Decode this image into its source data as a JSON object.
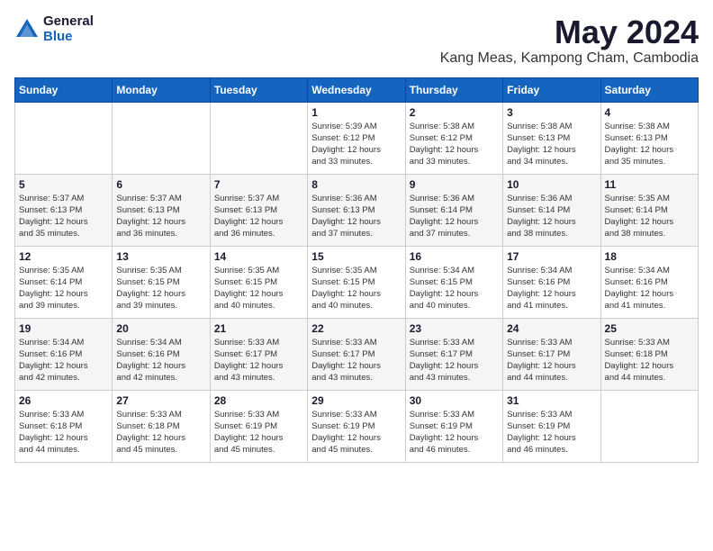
{
  "header": {
    "logo_general": "General",
    "logo_blue": "Blue",
    "month_title": "May 2024",
    "location": "Kang Meas, Kampong Cham, Cambodia"
  },
  "days_of_week": [
    "Sunday",
    "Monday",
    "Tuesday",
    "Wednesday",
    "Thursday",
    "Friday",
    "Saturday"
  ],
  "weeks": [
    [
      {
        "day": "",
        "info": ""
      },
      {
        "day": "",
        "info": ""
      },
      {
        "day": "",
        "info": ""
      },
      {
        "day": "1",
        "info": "Sunrise: 5:39 AM\nSunset: 6:12 PM\nDaylight: 12 hours\nand 33 minutes."
      },
      {
        "day": "2",
        "info": "Sunrise: 5:38 AM\nSunset: 6:12 PM\nDaylight: 12 hours\nand 33 minutes."
      },
      {
        "day": "3",
        "info": "Sunrise: 5:38 AM\nSunset: 6:13 PM\nDaylight: 12 hours\nand 34 minutes."
      },
      {
        "day": "4",
        "info": "Sunrise: 5:38 AM\nSunset: 6:13 PM\nDaylight: 12 hours\nand 35 minutes."
      }
    ],
    [
      {
        "day": "5",
        "info": "Sunrise: 5:37 AM\nSunset: 6:13 PM\nDaylight: 12 hours\nand 35 minutes."
      },
      {
        "day": "6",
        "info": "Sunrise: 5:37 AM\nSunset: 6:13 PM\nDaylight: 12 hours\nand 36 minutes."
      },
      {
        "day": "7",
        "info": "Sunrise: 5:37 AM\nSunset: 6:13 PM\nDaylight: 12 hours\nand 36 minutes."
      },
      {
        "day": "8",
        "info": "Sunrise: 5:36 AM\nSunset: 6:13 PM\nDaylight: 12 hours\nand 37 minutes."
      },
      {
        "day": "9",
        "info": "Sunrise: 5:36 AM\nSunset: 6:14 PM\nDaylight: 12 hours\nand 37 minutes."
      },
      {
        "day": "10",
        "info": "Sunrise: 5:36 AM\nSunset: 6:14 PM\nDaylight: 12 hours\nand 38 minutes."
      },
      {
        "day": "11",
        "info": "Sunrise: 5:35 AM\nSunset: 6:14 PM\nDaylight: 12 hours\nand 38 minutes."
      }
    ],
    [
      {
        "day": "12",
        "info": "Sunrise: 5:35 AM\nSunset: 6:14 PM\nDaylight: 12 hours\nand 39 minutes."
      },
      {
        "day": "13",
        "info": "Sunrise: 5:35 AM\nSunset: 6:15 PM\nDaylight: 12 hours\nand 39 minutes."
      },
      {
        "day": "14",
        "info": "Sunrise: 5:35 AM\nSunset: 6:15 PM\nDaylight: 12 hours\nand 40 minutes."
      },
      {
        "day": "15",
        "info": "Sunrise: 5:35 AM\nSunset: 6:15 PM\nDaylight: 12 hours\nand 40 minutes."
      },
      {
        "day": "16",
        "info": "Sunrise: 5:34 AM\nSunset: 6:15 PM\nDaylight: 12 hours\nand 40 minutes."
      },
      {
        "day": "17",
        "info": "Sunrise: 5:34 AM\nSunset: 6:16 PM\nDaylight: 12 hours\nand 41 minutes."
      },
      {
        "day": "18",
        "info": "Sunrise: 5:34 AM\nSunset: 6:16 PM\nDaylight: 12 hours\nand 41 minutes."
      }
    ],
    [
      {
        "day": "19",
        "info": "Sunrise: 5:34 AM\nSunset: 6:16 PM\nDaylight: 12 hours\nand 42 minutes."
      },
      {
        "day": "20",
        "info": "Sunrise: 5:34 AM\nSunset: 6:16 PM\nDaylight: 12 hours\nand 42 minutes."
      },
      {
        "day": "21",
        "info": "Sunrise: 5:33 AM\nSunset: 6:17 PM\nDaylight: 12 hours\nand 43 minutes."
      },
      {
        "day": "22",
        "info": "Sunrise: 5:33 AM\nSunset: 6:17 PM\nDaylight: 12 hours\nand 43 minutes."
      },
      {
        "day": "23",
        "info": "Sunrise: 5:33 AM\nSunset: 6:17 PM\nDaylight: 12 hours\nand 43 minutes."
      },
      {
        "day": "24",
        "info": "Sunrise: 5:33 AM\nSunset: 6:17 PM\nDaylight: 12 hours\nand 44 minutes."
      },
      {
        "day": "25",
        "info": "Sunrise: 5:33 AM\nSunset: 6:18 PM\nDaylight: 12 hours\nand 44 minutes."
      }
    ],
    [
      {
        "day": "26",
        "info": "Sunrise: 5:33 AM\nSunset: 6:18 PM\nDaylight: 12 hours\nand 44 minutes."
      },
      {
        "day": "27",
        "info": "Sunrise: 5:33 AM\nSunset: 6:18 PM\nDaylight: 12 hours\nand 45 minutes."
      },
      {
        "day": "28",
        "info": "Sunrise: 5:33 AM\nSunset: 6:19 PM\nDaylight: 12 hours\nand 45 minutes."
      },
      {
        "day": "29",
        "info": "Sunrise: 5:33 AM\nSunset: 6:19 PM\nDaylight: 12 hours\nand 45 minutes."
      },
      {
        "day": "30",
        "info": "Sunrise: 5:33 AM\nSunset: 6:19 PM\nDaylight: 12 hours\nand 46 minutes."
      },
      {
        "day": "31",
        "info": "Sunrise: 5:33 AM\nSunset: 6:19 PM\nDaylight: 12 hours\nand 46 minutes."
      },
      {
        "day": "",
        "info": ""
      }
    ]
  ]
}
